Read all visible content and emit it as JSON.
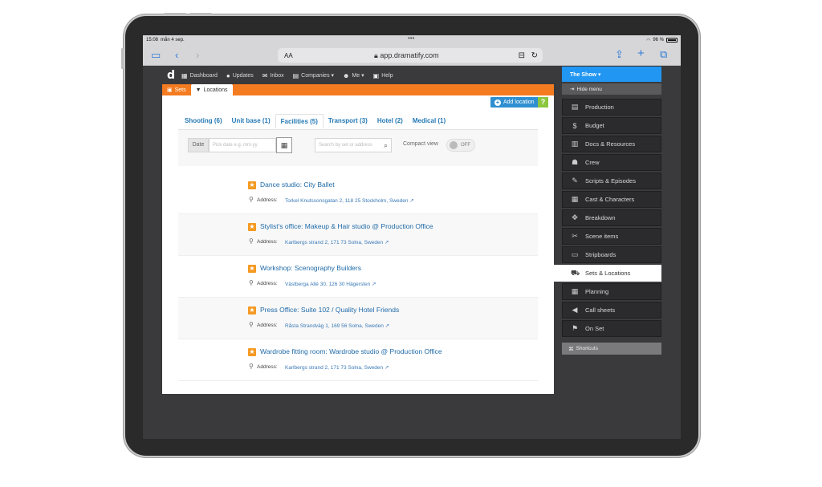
{
  "status_bar": {
    "time": "15:08",
    "date": "mån 4 sep.",
    "battery": "96 %"
  },
  "browser": {
    "text_size": "AA",
    "url": "app.dramatify.com"
  },
  "app_nav": {
    "logo": "d",
    "items": [
      {
        "icon": "dashboard-icon",
        "label": "Dashboard"
      },
      {
        "icon": "updates-icon",
        "label": "Updates"
      },
      {
        "icon": "inbox-icon",
        "label": "Inbox"
      },
      {
        "icon": "companies-icon",
        "label": "Companies ▾"
      },
      {
        "icon": "user-icon",
        "label": "Me ▾"
      },
      {
        "icon": "help-icon",
        "label": "Help"
      }
    ]
  },
  "top_tabs": {
    "sets": "Sets",
    "locations": "Locations"
  },
  "actions": {
    "add_location": "Add location",
    "help": "?"
  },
  "category_tabs": [
    "Shooting (6)",
    "Unit base (1)",
    "Facilities (5)",
    "Transport (3)",
    "Hotel (2)",
    "Medical (1)"
  ],
  "filters": {
    "date_label": "Date",
    "date_placeholder": "Pick date e.g. mm.yy",
    "search_placeholder": "Search by set or address",
    "compact_label": "Compact view",
    "compact_value": "OFF"
  },
  "address_label": "Address:",
  "locations": [
    {
      "title": "Dance studio: City Ballet",
      "address": "Torkel Knutssonsgatan 2, 118 25 Stockholm, Sweden ↗"
    },
    {
      "title": "Stylist's office: Makeup & Hair studio @ Production Office",
      "address": "Karlbergs strand 2, 171 73 Solna, Sweden ↗"
    },
    {
      "title": "Workshop: Scenography Builders",
      "address": "Västberga Allé 30, 126 30 Hägersten ↗"
    },
    {
      "title": "Press Office: Suite 102 / Quality Hotel Friends",
      "address": "Råsta Strandväg 1, 169 56 Solna, Sweden ↗"
    },
    {
      "title": "Wardrobe fitting room: Wardrobe studio @ Production Office",
      "address": "Karlbergs strand 2, 171 73 Solna, Sweden ↗"
    }
  ],
  "sidebar": {
    "show_label": "The Show ▾",
    "hide_label": "Hide menu",
    "items": [
      {
        "icon": "production-icon",
        "label": "Production"
      },
      {
        "icon": "budget-icon",
        "label": "Budget"
      },
      {
        "icon": "docs-icon",
        "label": "Docs & Resources"
      },
      {
        "icon": "crew-icon",
        "label": "Crew"
      },
      {
        "icon": "scripts-icon",
        "label": "Scripts & Episodes"
      },
      {
        "icon": "cast-icon",
        "label": "Cast & Characters"
      },
      {
        "icon": "breakdown-icon",
        "label": "Breakdown"
      },
      {
        "icon": "scene-items-icon",
        "label": "Scene items"
      },
      {
        "icon": "stripboards-icon",
        "label": "Stripboards"
      },
      {
        "icon": "sets-locations-icon",
        "label": "Sets & Locations"
      },
      {
        "icon": "planning-icon",
        "label": "Planning"
      },
      {
        "icon": "call-sheets-icon",
        "label": "Call sheets"
      },
      {
        "icon": "on-set-icon",
        "label": "On Set"
      }
    ],
    "active_index": 9,
    "shortcuts_label": "Shortcuts"
  },
  "colors": {
    "accent_orange": "#f47b20",
    "link_blue": "#1f6aa8",
    "primary_blue": "#2196f3"
  }
}
